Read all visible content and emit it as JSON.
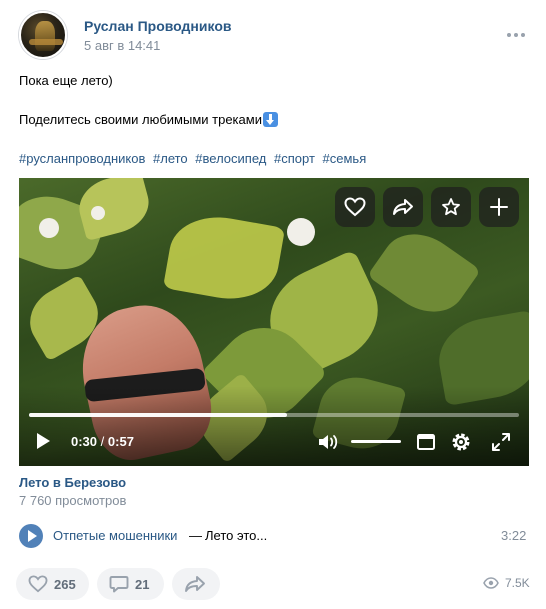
{
  "post": {
    "author": "Руслан Проводников",
    "date": "5 авг в 14:41",
    "text_line1": "Пока еще лето)",
    "text_line2": "Поделитесь своими любимыми треками",
    "hashtags": [
      "#русланпроводников",
      "#лето",
      "#велосипед",
      "#спорт",
      "#семья"
    ]
  },
  "video": {
    "time_current": "0:30",
    "time_separator": "/",
    "time_total": "0:57",
    "progress": 0.526,
    "title": "Лето в Березово",
    "views": "7 760 просмотров",
    "overlay_actions": [
      "heart-icon",
      "share-icon",
      "star-icon",
      "plus-icon"
    ]
  },
  "audio": {
    "artist": "Отпетые мошенники",
    "dash": "—",
    "title": "Лето это...",
    "duration": "3:22"
  },
  "footer": {
    "likes": "265",
    "comments": "21",
    "views": "7.5K"
  },
  "colors": {
    "link": "#2a5885",
    "muted": "#818c99",
    "accent": "#5181b8",
    "pill_bg": "#f2f3f5"
  }
}
